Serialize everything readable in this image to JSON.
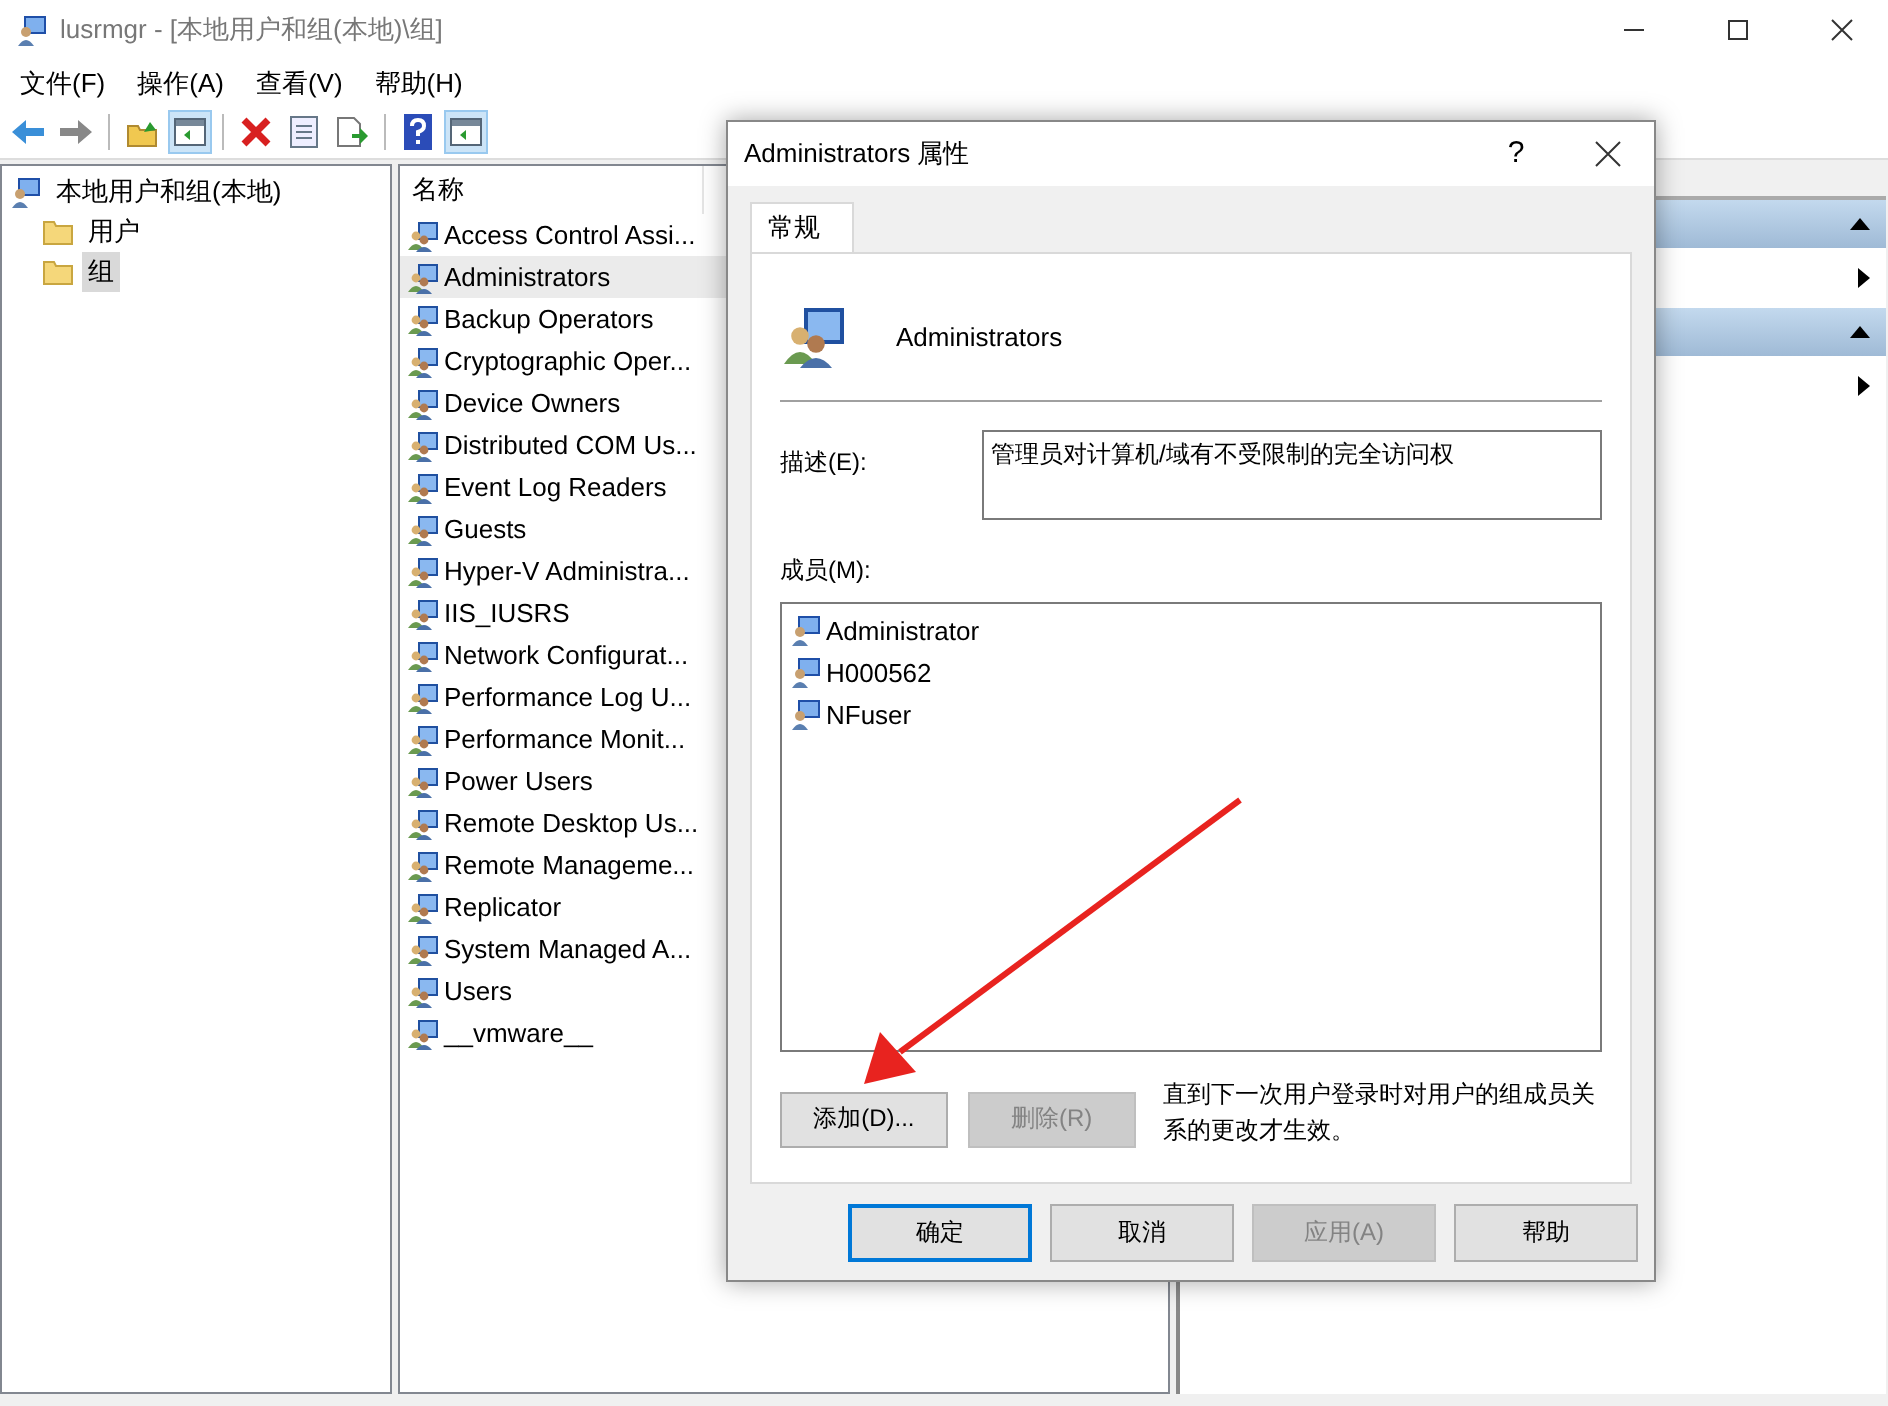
{
  "window": {
    "title": "lusrmgr - [本地用户和组(本地)\\组]"
  },
  "menu": [
    "文件(F)",
    "操作(A)",
    "查看(V)",
    "帮助(H)"
  ],
  "toolbar": [
    [
      {
        "kind": "back",
        "on": false
      },
      {
        "kind": "forward",
        "on": false
      }
    ],
    [
      {
        "kind": "up",
        "on": false
      },
      {
        "kind": "tree",
        "on": true
      }
    ],
    [
      {
        "kind": "delete",
        "on": false
      },
      {
        "kind": "properties",
        "on": false
      },
      {
        "kind": "export",
        "on": false
      }
    ],
    [
      {
        "kind": "help",
        "on": false
      },
      {
        "kind": "actions",
        "on": true
      }
    ]
  ],
  "tree": [
    {
      "label": "本地用户和组(本地)",
      "selected": false,
      "children": [
        {
          "label": "用户",
          "selected": false
        },
        {
          "label": "组",
          "selected": true
        }
      ]
    }
  ],
  "list": {
    "columns": [
      "名称"
    ],
    "rows": [
      {
        "name": "Access Control Assi...",
        "selected": false
      },
      {
        "name": "Administrators",
        "selected": true
      },
      {
        "name": "Backup Operators",
        "selected": false
      },
      {
        "name": "Cryptographic Oper...",
        "selected": false
      },
      {
        "name": "Device Owners",
        "selected": false
      },
      {
        "name": "Distributed COM Us...",
        "selected": false
      },
      {
        "name": "Event Log Readers",
        "selected": false
      },
      {
        "name": "Guests",
        "selected": false
      },
      {
        "name": "Hyper-V Administra...",
        "selected": false
      },
      {
        "name": "IIS_IUSRS",
        "selected": false
      },
      {
        "name": "Network Configurat...",
        "selected": false
      },
      {
        "name": "Performance Log U...",
        "selected": false
      },
      {
        "name": "Performance Monit...",
        "selected": false
      },
      {
        "name": "Power Users",
        "selected": false
      },
      {
        "name": "Remote Desktop Us...",
        "selected": false
      },
      {
        "name": "Remote Manageme...",
        "selected": false
      },
      {
        "name": "Replicator",
        "selected": false
      },
      {
        "name": "System Managed A...",
        "selected": false
      },
      {
        "name": "Users",
        "selected": false
      },
      {
        "name": "__vmware__",
        "selected": false
      }
    ]
  },
  "actions": [
    {
      "expanded": true
    },
    {
      "expanded": true
    }
  ],
  "dialog": {
    "title": "Administrators 属性",
    "help": "?",
    "tabs": [
      {
        "label": "常规",
        "selected": true
      }
    ],
    "group_name": "Administrators",
    "description": {
      "label": "描述(E):",
      "value": "管理员对计算机/域有不受限制的完全访问权"
    },
    "members": {
      "label": "成员(M):",
      "items": [
        "Administrator",
        "H000562",
        "NFuser"
      ]
    },
    "add": {
      "label": "添加(D)...",
      "disabled": false
    },
    "remove": {
      "label": "删除(R)",
      "disabled": true
    },
    "note": "直到下一次用户登录时对用户的组成员关系的更改才生效。",
    "buttons": [
      {
        "label": "确定",
        "default": true,
        "disabled": false
      },
      {
        "label": "取消",
        "default": false,
        "disabled": false
      },
      {
        "label": "应用(A)",
        "default": false,
        "disabled": true
      },
      {
        "label": "帮助",
        "default": false,
        "disabled": false
      }
    ]
  }
}
